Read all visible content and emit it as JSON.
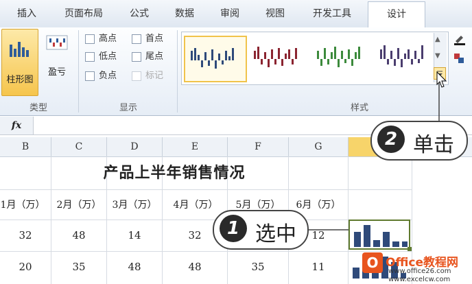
{
  "tabs": [
    "插入",
    "页面布局",
    "公式",
    "数据",
    "审阅",
    "视图",
    "开发工具",
    "设计"
  ],
  "ribbon": {
    "type_buttons": {
      "column": "柱形图",
      "winloss": "盈亏"
    },
    "show_checks": {
      "high": "高点",
      "first": "首点",
      "low": "低点",
      "last": "尾点",
      "negative": "负点",
      "markers": "标记"
    },
    "groups": {
      "type": "类型",
      "show": "显示",
      "style": "样式"
    }
  },
  "formula_bar": {
    "fx": "fx"
  },
  "columns": [
    "B",
    "C",
    "D",
    "E",
    "F",
    "G"
  ],
  "sheet": {
    "title": "产品上半年销售情况",
    "headers": [
      "1月（万）",
      "2月（万）",
      "3月（万）",
      "4月（万）",
      "5月（万）",
      "6月（万）"
    ],
    "rows": [
      [
        "32",
        "48",
        "14",
        "32",
        "",
        "12"
      ],
      [
        "20",
        "35",
        "48",
        "48",
        "35",
        "11"
      ]
    ]
  },
  "callouts": {
    "click": {
      "num": "2",
      "text": "单击"
    },
    "select": {
      "num": "1",
      "text": "选中"
    }
  },
  "watermark": {
    "line1": "Office教程网",
    "line2": "www.office26.com",
    "line3": "www.excelcw.com"
  },
  "colors": {
    "accent": "#2f4a7a",
    "sparkline_red": "#8b2430",
    "sparkline_green": "#3c8a3c",
    "sparkline_purple": "#4a3d6e",
    "highlight": "#f5c242"
  }
}
